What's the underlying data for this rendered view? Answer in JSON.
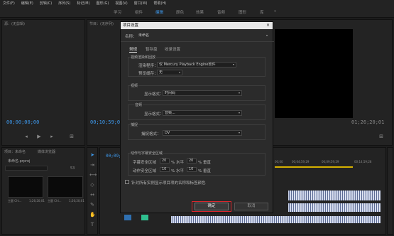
{
  "menu": [
    "文件(F)",
    "编辑(E)",
    "剪辑(C)",
    "序列(S)",
    "标记(M)",
    "图形(G)",
    "视图(V)",
    "窗口(W)",
    "帮助(H)"
  ],
  "workspace_tabs": [
    "学习",
    "组件",
    "编辑",
    "颜色",
    "效果",
    "音频",
    "图形",
    "库"
  ],
  "workspace_more": "»",
  "source_panel": {
    "title": "源：(无剪辑)",
    "timecode": "00;00;00;00"
  },
  "program_panel": {
    "title": "节目：(无序列)",
    "timecode_left": "00;10;59;00",
    "timecode_right": "01;26;20;01"
  },
  "project_panel": {
    "title": "项目：未命名",
    "tab2": "媒体浏览器",
    "filename": "未命名.prproj",
    "count": "53",
    "clips": [
      {
        "name": "主题 Chi...",
        "duration": "1;26;20;01"
      },
      {
        "name": "主题 Chi...",
        "duration": "1;26;20;01"
      }
    ]
  },
  "timeline": {
    "tc": "00;09;56;09",
    "rulers": [
      "00;00",
      "00;04;59;29",
      "00;09;59;29",
      "00;14;59;28"
    ]
  },
  "dialog": {
    "title": "项目设置",
    "close": "×",
    "name_label": "名称：",
    "name_value": "未命名",
    "tabs": [
      "常规",
      "暂存盘",
      "收录设置"
    ],
    "renderer_group": "视频渲染和回放",
    "renderer_label": "渲染程序：",
    "renderer_value": "仅 Mercury Playback Engine软件",
    "preview_label": "预览缓存：",
    "preview_value": "无",
    "video_group": "视频",
    "video_format_label": "显示格式：",
    "video_format_value": "时间码",
    "audio_group": "音频",
    "audio_format_label": "显示格式：",
    "audio_format_value": "音频...",
    "capture_group": "捕捉",
    "capture_format_label": "捕捉格式：",
    "capture_format_value": "DV",
    "safe_group": "动作与字幕安全区域",
    "title_safe_label": "字幕安全区域",
    "title_safe_h": "20",
    "title_safe_v": "20",
    "action_safe_label": "动作安全区域",
    "action_safe_h": "10",
    "action_safe_v": "10",
    "h_label": "% 水平",
    "v_label": "% 垂直",
    "aspect_label": "% 水平",
    "checkbox_label": "针对所有实例显示项目项的名称和标签颜色",
    "ok_label": "确定",
    "cancel_label": "取消"
  },
  "colors": {
    "accent": "#3e9bf0",
    "highlight": "#d9262c"
  }
}
